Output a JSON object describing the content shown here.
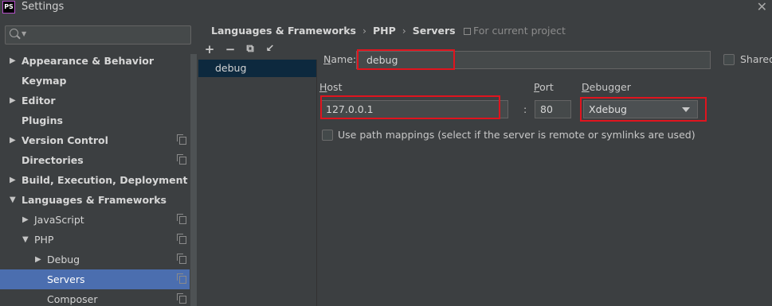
{
  "window": {
    "title": "Settings",
    "logo_text": "PS"
  },
  "sidebar": {
    "items": [
      {
        "label": "Appearance & Behavior",
        "bold": true,
        "arrow": "▶",
        "proj": false
      },
      {
        "label": "Keymap",
        "bold": true,
        "arrow": "",
        "proj": false
      },
      {
        "label": "Editor",
        "bold": true,
        "arrow": "▶",
        "proj": false
      },
      {
        "label": "Plugins",
        "bold": true,
        "arrow": "",
        "proj": false
      },
      {
        "label": "Version Control",
        "bold": true,
        "arrow": "▶",
        "proj": true
      },
      {
        "label": "Directories",
        "bold": true,
        "arrow": "",
        "proj": true
      },
      {
        "label": "Build, Execution, Deployment",
        "bold": true,
        "arrow": "▶",
        "proj": false
      },
      {
        "label": "Languages & Frameworks",
        "bold": true,
        "arrow": "▼",
        "proj": false
      },
      {
        "label": "JavaScript",
        "bold": false,
        "arrow": "▶",
        "proj": true
      },
      {
        "label": "PHP",
        "bold": false,
        "arrow": "▼",
        "proj": true
      },
      {
        "label": "Debug",
        "bold": false,
        "arrow": "▶",
        "proj": true
      },
      {
        "label": "Servers",
        "bold": false,
        "arrow": "",
        "proj": true,
        "selected": true
      },
      {
        "label": "Composer",
        "bold": false,
        "arrow": "",
        "proj": true
      }
    ]
  },
  "breadcrumb": {
    "part1": "Languages & Frameworks",
    "part2": "PHP",
    "part3": "Servers",
    "separator": "›"
  },
  "for_project": "For current project",
  "toolbar": {
    "add": "+",
    "remove": "−",
    "copy": "⧉",
    "import": "↙"
  },
  "servers": [
    {
      "name": "debug"
    }
  ],
  "form": {
    "name_label_ul": "N",
    "name_label_rest": "ame:",
    "name_value": "debug",
    "shared_label": "Shared",
    "host_label_ul": "H",
    "host_label_rest": "ost",
    "host_value": "127.0.0.1",
    "port_label_ul": "P",
    "port_label_rest": "ort",
    "port_value": "80",
    "colon": ":",
    "debugger_label_ul": "D",
    "debugger_label_rest": "ebugger",
    "debugger_value": "Xdebug",
    "path_mappings_label": "Use path mappings (select if the server is remote or symlinks are used)"
  },
  "colors": {
    "selection": "#4b6eaf",
    "highlight_box": "#e0141e",
    "list_selection": "#0d293e"
  }
}
